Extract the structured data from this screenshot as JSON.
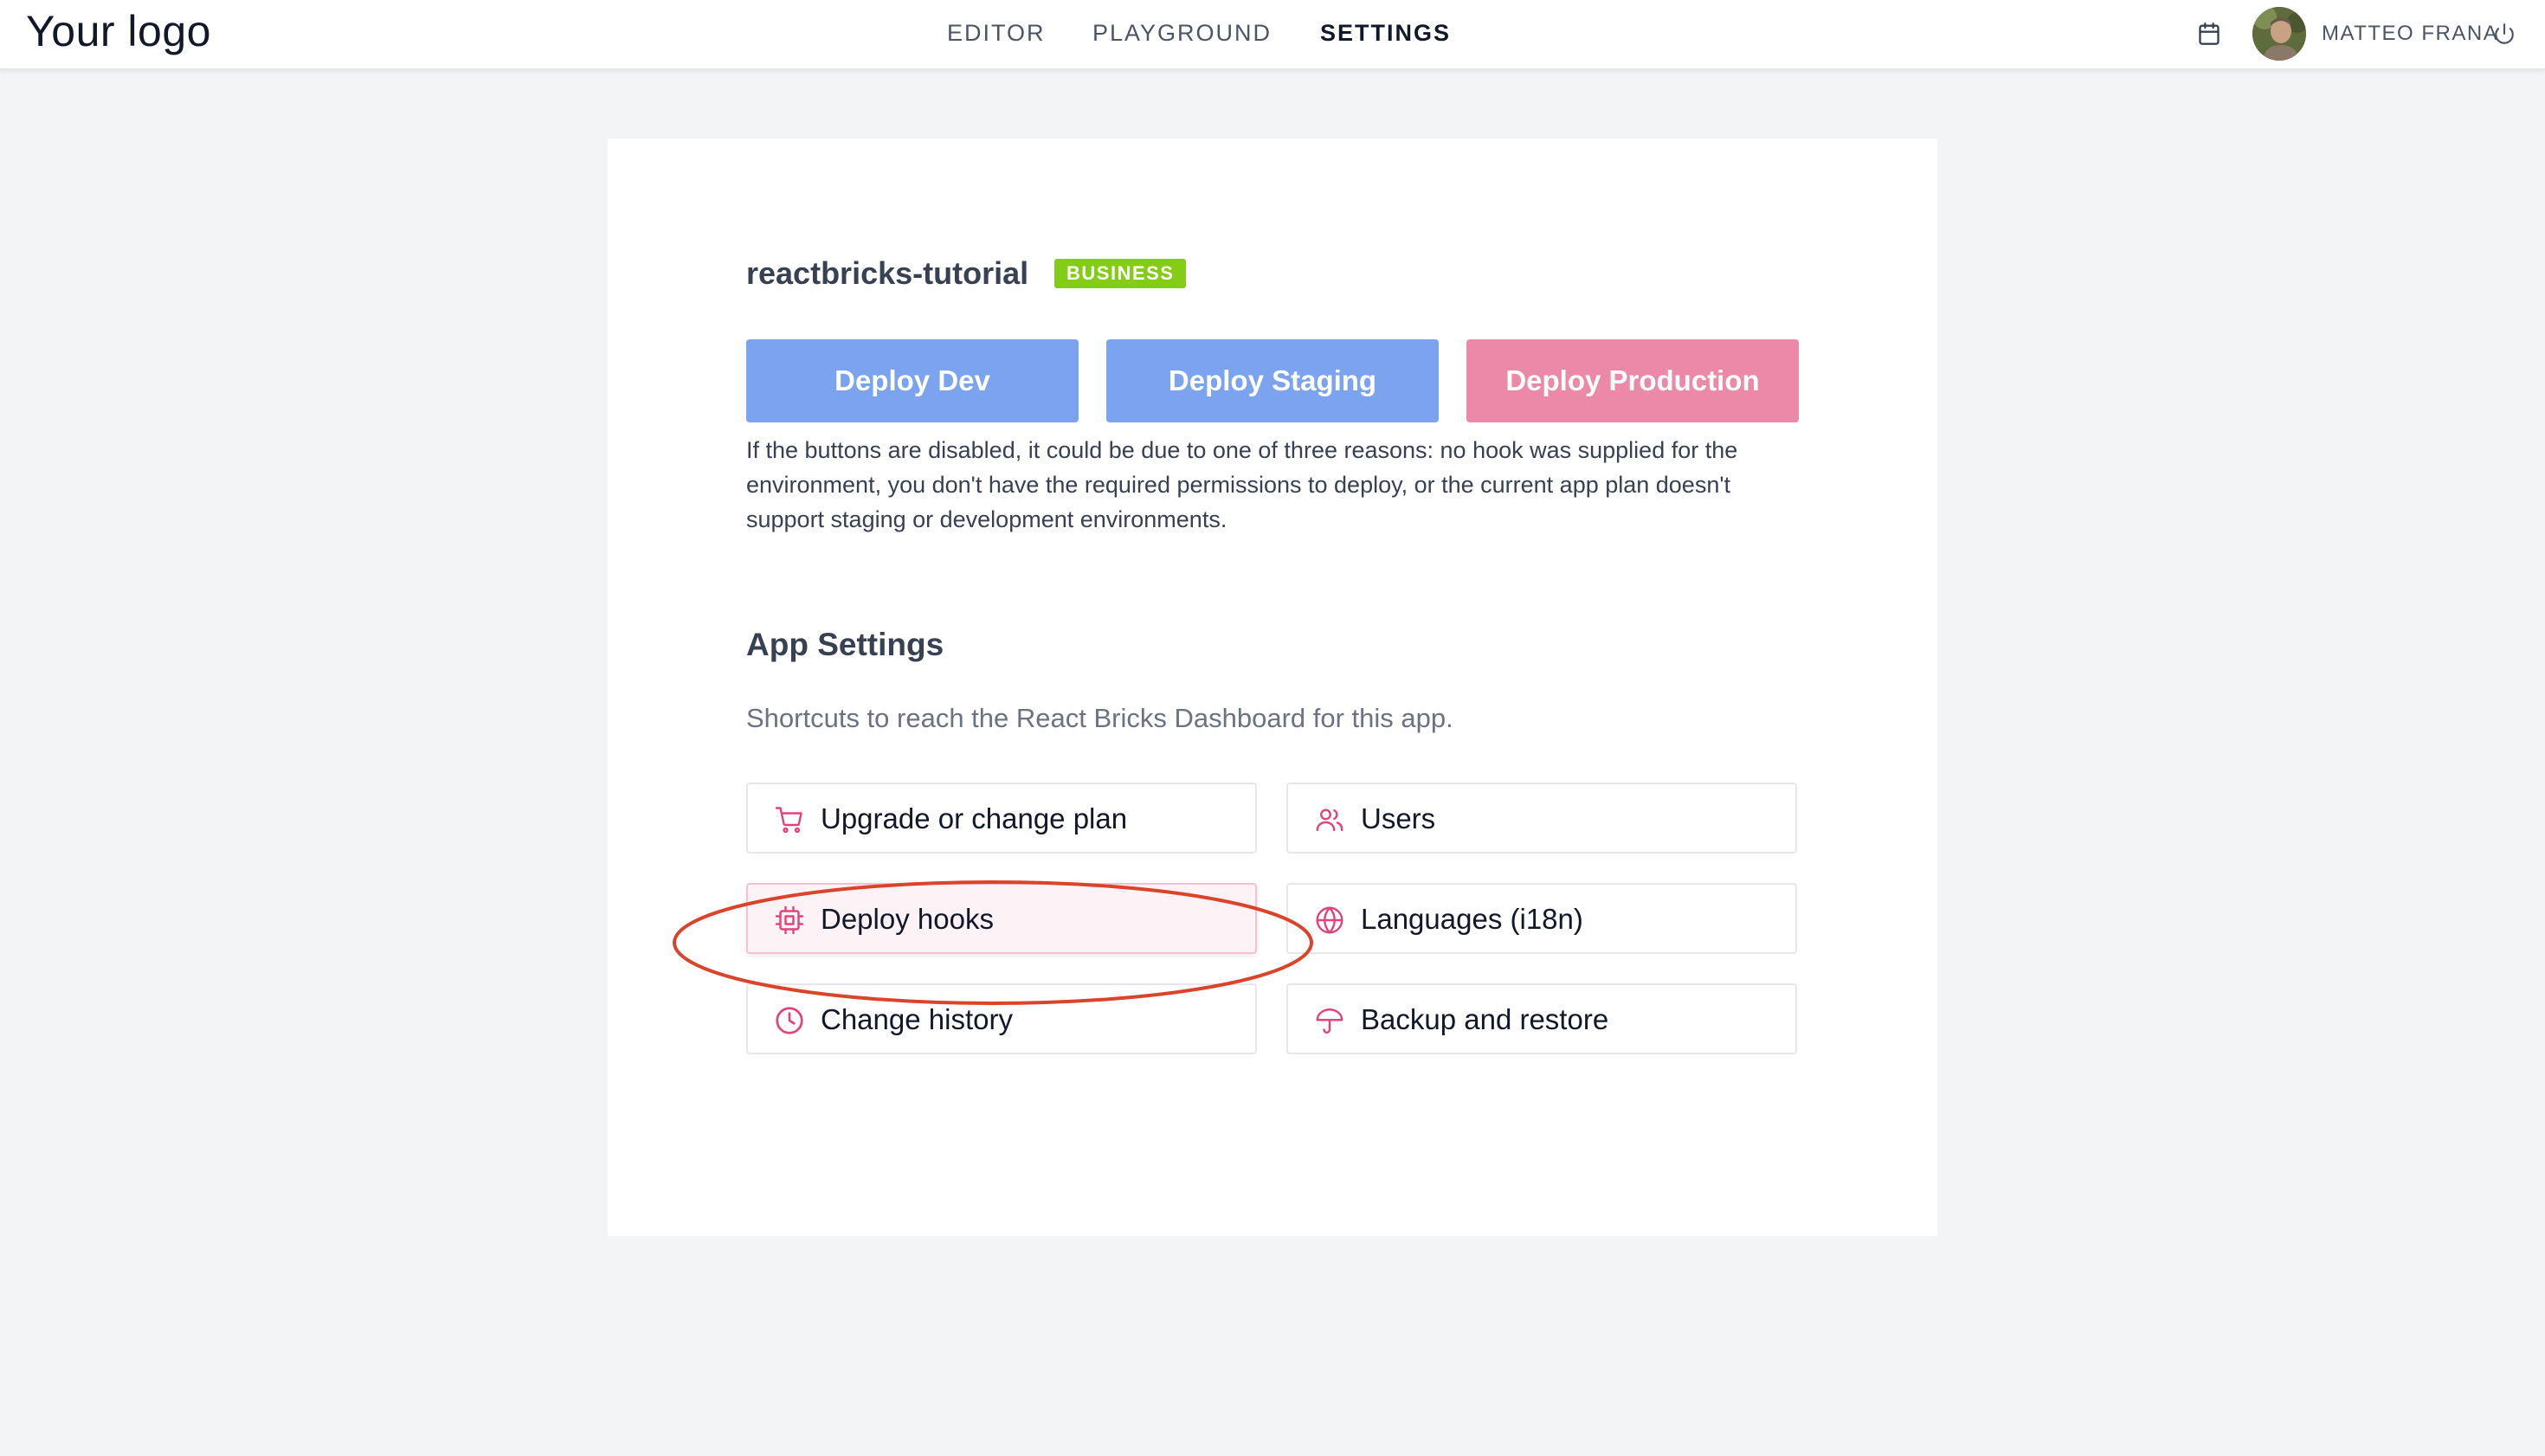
{
  "header": {
    "logo_text": "Your logo",
    "nav": [
      {
        "label": "EDITOR"
      },
      {
        "label": "PLAYGROUND"
      },
      {
        "label": "SETTINGS",
        "active": true
      }
    ],
    "user": {
      "name": "MATTEO FRANA",
      "icons": [
        "calendar-icon",
        "avatar",
        "power-icon"
      ]
    }
  },
  "app": {
    "name": "reactbricks-tutorial",
    "plan_badge": "BUSINESS"
  },
  "deploy": {
    "dev_label": "Deploy Dev",
    "staging_label": "Deploy Staging",
    "production_label": "Deploy Production",
    "help_text": "If the buttons are disabled, it could be due to one of three reasons: no hook was supplied for the environment, you don't have the required permissions to deploy, or the current app plan doesn't support staging or development environments."
  },
  "app_settings": {
    "title": "App Settings",
    "subtitle": "Shortcuts to reach the React Bricks Dashboard for this app.",
    "links": [
      {
        "label": "Upgrade or change plan",
        "icon": "cart-icon"
      },
      {
        "label": "Users",
        "icon": "users-icon"
      },
      {
        "label": "Deploy hooks",
        "icon": "chip-icon",
        "highlighted": true
      },
      {
        "label": "Languages (i18n)",
        "icon": "globe-icon"
      },
      {
        "label": "Change history",
        "icon": "clock-icon"
      },
      {
        "label": "Backup and restore",
        "icon": "umbrella-icon"
      }
    ]
  },
  "colors": {
    "accent_pink": "#e0447a",
    "deploy_blue": "#7ba3ef",
    "deploy_pink": "#ec89a9",
    "badge_green": "#84cc16",
    "annotation_red": "#d9442b"
  }
}
